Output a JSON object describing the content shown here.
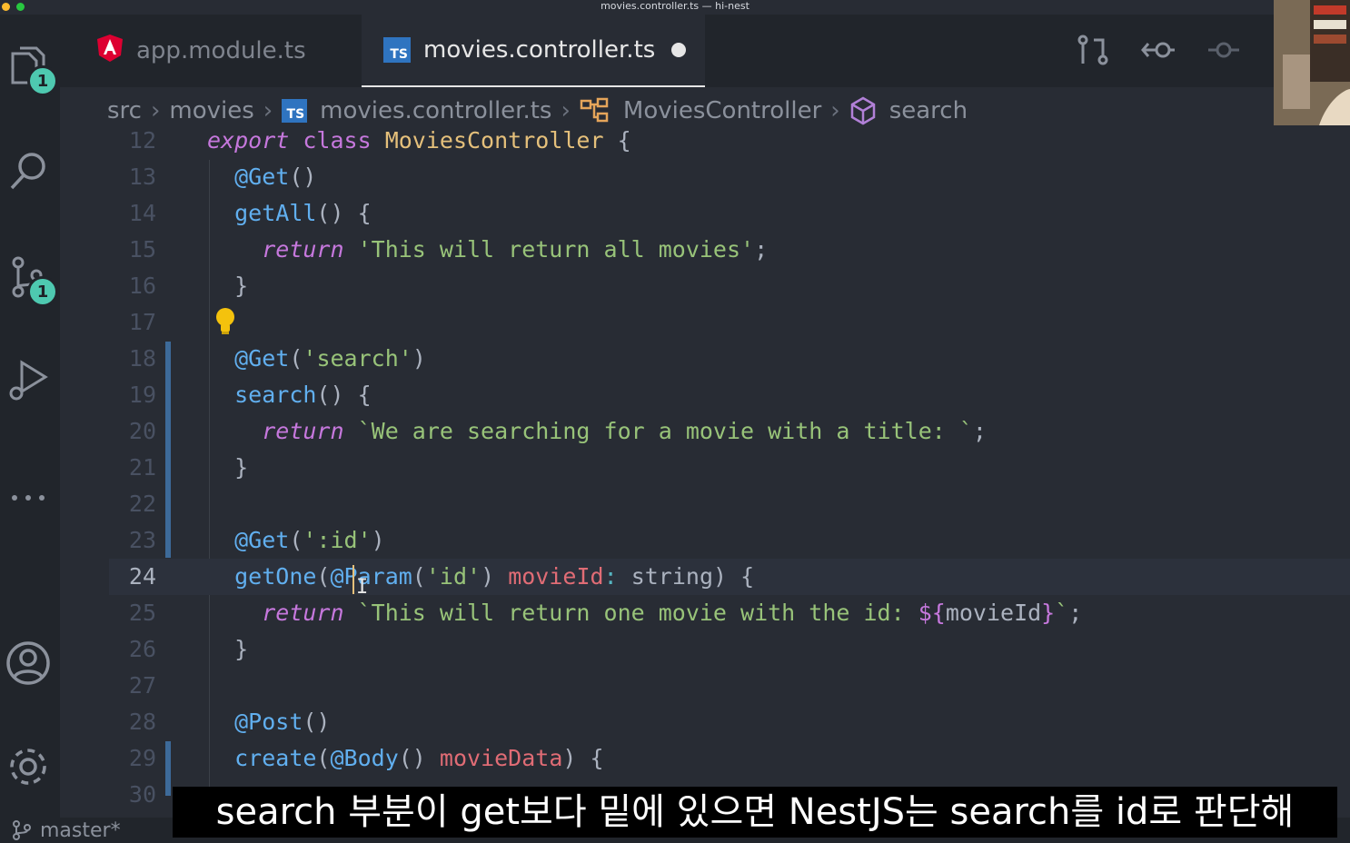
{
  "window": {
    "title": "movies.controller.ts — hi-nest"
  },
  "activity_bar": {
    "explorer_badge": "1",
    "scm_badge": "1"
  },
  "tabs": [
    {
      "label": "app.module.ts",
      "icon": "angular-icon",
      "active": false
    },
    {
      "label": "movies.controller.ts",
      "icon": "typescript-icon",
      "active": true,
      "dirty": true
    }
  ],
  "breadcrumb": [
    "src",
    "movies",
    "movies.controller.ts",
    "MoviesController",
    "search"
  ],
  "code": {
    "lines": [
      {
        "n": "12"
      },
      {
        "n": "13"
      },
      {
        "n": "14"
      },
      {
        "n": "15"
      },
      {
        "n": "16"
      },
      {
        "n": "17"
      },
      {
        "n": "18"
      },
      {
        "n": "19"
      },
      {
        "n": "20"
      },
      {
        "n": "21"
      },
      {
        "n": "22"
      },
      {
        "n": "23"
      },
      {
        "n": "24"
      },
      {
        "n": "25"
      },
      {
        "n": "26"
      },
      {
        "n": "27"
      },
      {
        "n": "28"
      },
      {
        "n": "29"
      },
      {
        "n": "30"
      }
    ]
  },
  "status_bar": {
    "branch": "master*"
  },
  "subtitle": "search 부분이 get보다 밑에 있으면 NestJS는 search를 id로 판단해",
  "colors": {
    "background": "#282c34",
    "sidebar": "#21252b",
    "accent": "#4ec9b0",
    "keyword": "#c678dd",
    "string": "#98c379",
    "function": "#61afef",
    "class": "#e5c07b",
    "param": "#e06c75"
  }
}
